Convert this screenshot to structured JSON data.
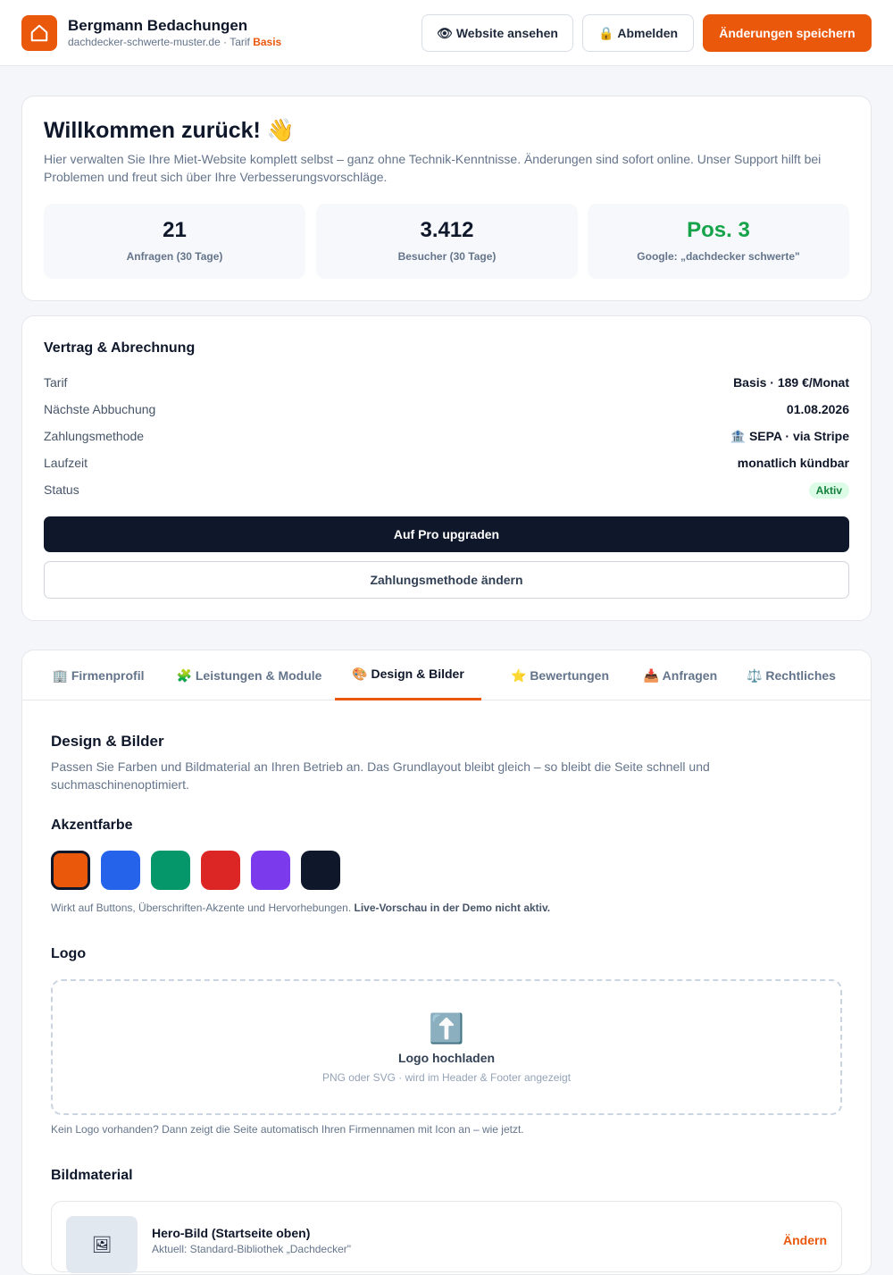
{
  "header": {
    "company": "Bergmann Bedachungen",
    "domain_text": "dachdecker-schwerte-muster.de · Tarif ",
    "tier": "Basis",
    "view_site_icon": "👁",
    "view_site_label": "Website ansehen",
    "logout_icon": "🔒",
    "logout_label": "Abmelden",
    "save_label": "Änderungen speichern"
  },
  "welcome": {
    "title": "Willkommen zurück! 👋",
    "text": "Hier verwalten Sie Ihre Miet-Website komplett selbst – ganz ohne Technik-Kenntnisse. Änderungen sind sofort online. Unser Support hilft bei Problemen und freut sich über Ihre Verbesserungsvorschläge.",
    "stats": [
      {
        "value": "21",
        "label": "Anfragen (30 Tage)"
      },
      {
        "value": "3.412",
        "label": "Besucher (30 Tage)"
      },
      {
        "value": "Pos. 3",
        "label": "Google: „dachdecker schwerte\""
      }
    ]
  },
  "contract": {
    "title": "Vertrag & Abrechnung",
    "rows": [
      {
        "key": "Tarif",
        "value": "Basis · 189 €/Monat"
      },
      {
        "key": "Nächste Abbuchung",
        "value": "01.08.2026"
      },
      {
        "key": "Zahlungsmethode",
        "value": "🏦 SEPA · via Stripe"
      },
      {
        "key": "Laufzeit",
        "value": "monatlich kündbar"
      },
      {
        "key": "Status",
        "value": "Aktiv"
      }
    ],
    "upgrade_label": "Auf Pro upgraden",
    "change_payment_label": "Zahlungsmethode ändern"
  },
  "tabs": [
    {
      "label": "🏢 Firmenprofil",
      "active": false
    },
    {
      "label": "🧩 Leistungen & Module",
      "active": false
    },
    {
      "label": "🎨 Design & Bilder",
      "active": true
    },
    {
      "label": "⭐ Bewertungen",
      "active": false
    },
    {
      "label": "📥 Anfragen",
      "active": false
    },
    {
      "label": "⚖️ Rechtliches",
      "active": false
    }
  ],
  "design": {
    "title": "Design & Bilder",
    "intro": "Passen Sie Farben und Bildmaterial an Ihren Betrieb an. Das Grundlayout bleibt gleich – so bleibt die Seite schnell und suchmaschinenoptimiert.",
    "accent_title": "Akzentfarbe",
    "accent_colors": [
      "#ea580c",
      "#2563eb",
      "#059669",
      "#dc2626",
      "#7c3aed",
      "#0f172a"
    ],
    "accent_selected": "#ea580c",
    "accent_note": "Wirkt auf Buttons, Überschriften-Akzente und Hervorhebungen. ",
    "accent_note_bold": "Live-Vorschau in der Demo nicht aktiv.",
    "logo_title": "Logo",
    "upload_icon": "⬆️",
    "upload_title": "Logo hochladen",
    "upload_sub": "PNG oder SVG · wird im Header & Footer angezeigt",
    "logo_note": "Kein Logo vorhanden? Dann zeigt die Seite automatisch Ihren Firmennamen mit Icon an – wie jetzt.",
    "images_title": "Bildmaterial",
    "images": [
      {
        "icon": "🖼",
        "title": "Hero-Bild (Startseite oben)",
        "sub": "Aktuell: Standard-Bibliothek „Dachdecker\"",
        "action": "Ändern"
      }
    ]
  }
}
